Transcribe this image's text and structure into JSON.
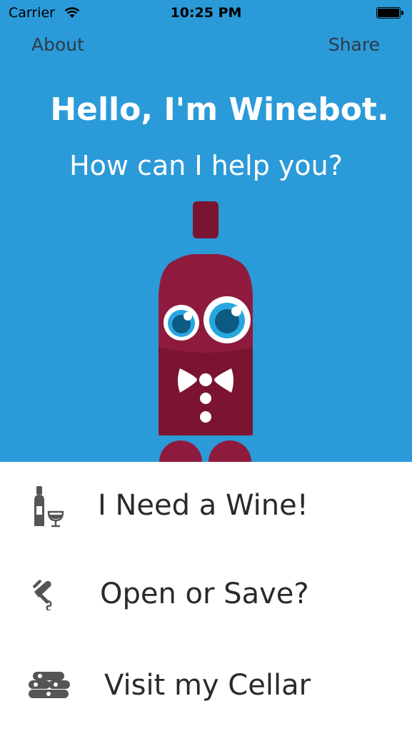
{
  "status_bar": {
    "carrier": "Carrier",
    "time": "10:25 PM",
    "icons": [
      "wifi-icon",
      "battery-icon"
    ]
  },
  "nav": {
    "about_label": "About",
    "share_label": "Share"
  },
  "hero": {
    "title": "Hello, I'm Winebot.",
    "subtitle": "How can I help you?",
    "background_color": "#2b9ad8",
    "mascot_color": "#8e1b3e"
  },
  "menu": {
    "items": [
      {
        "label": "I Need a Wine!",
        "icon": "wine-bottle-glass-icon"
      },
      {
        "label": "Open or Save?",
        "icon": "corkscrew-icon"
      },
      {
        "label": "Visit my Cellar",
        "icon": "wine-cellar-icon"
      }
    ]
  }
}
